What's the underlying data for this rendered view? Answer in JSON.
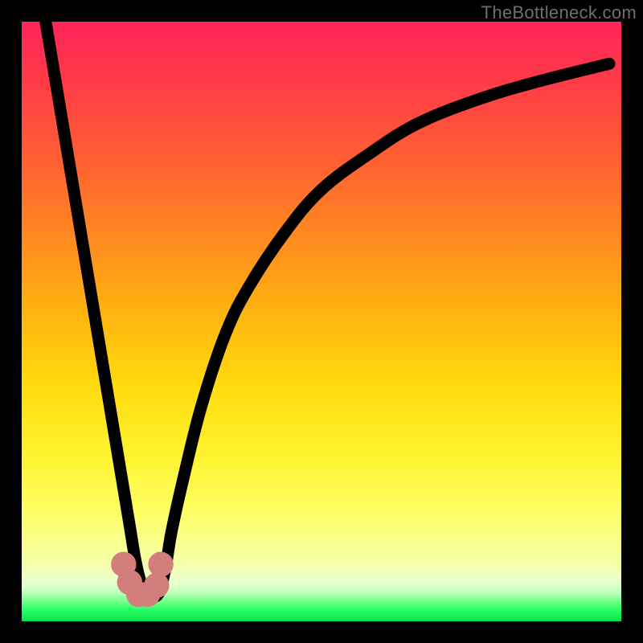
{
  "watermark": "TheBottleneck.com",
  "colors": {
    "frame": "#000000",
    "curve": "#000000",
    "marker": "#d47d7d",
    "gradient_top": "#ff2459",
    "gradient_bottom": "#07e24e"
  },
  "chart_data": {
    "type": "line",
    "title": "",
    "xlabel": "",
    "ylabel": "",
    "xlim": [
      0,
      100
    ],
    "ylim": [
      0,
      100
    ],
    "x": [
      4,
      6,
      8,
      10,
      12,
      14,
      16,
      17,
      18,
      19,
      20,
      21,
      22,
      23,
      24,
      25,
      27,
      30,
      34,
      38,
      44,
      50,
      58,
      66,
      76,
      86,
      98
    ],
    "y": [
      100,
      88,
      76,
      64,
      52,
      40,
      28,
      22,
      16,
      10,
      6,
      4,
      4,
      5,
      9,
      15,
      24,
      36,
      48,
      56,
      65,
      72,
      78,
      83,
      87,
      90,
      93
    ],
    "markers": [
      {
        "x": 17.0,
        "y": 9.5
      },
      {
        "x": 18.0,
        "y": 6.5
      },
      {
        "x": 19.5,
        "y": 4.5
      },
      {
        "x": 21.0,
        "y": 4.5
      },
      {
        "x": 22.5,
        "y": 6.0
      },
      {
        "x": 23.2,
        "y": 9.5
      }
    ],
    "marker_radius": 1.6,
    "note": "x and y are in percent of plot area; y measured from bottom (0) to top (100). Values are visual estimates from the rendered curve."
  }
}
